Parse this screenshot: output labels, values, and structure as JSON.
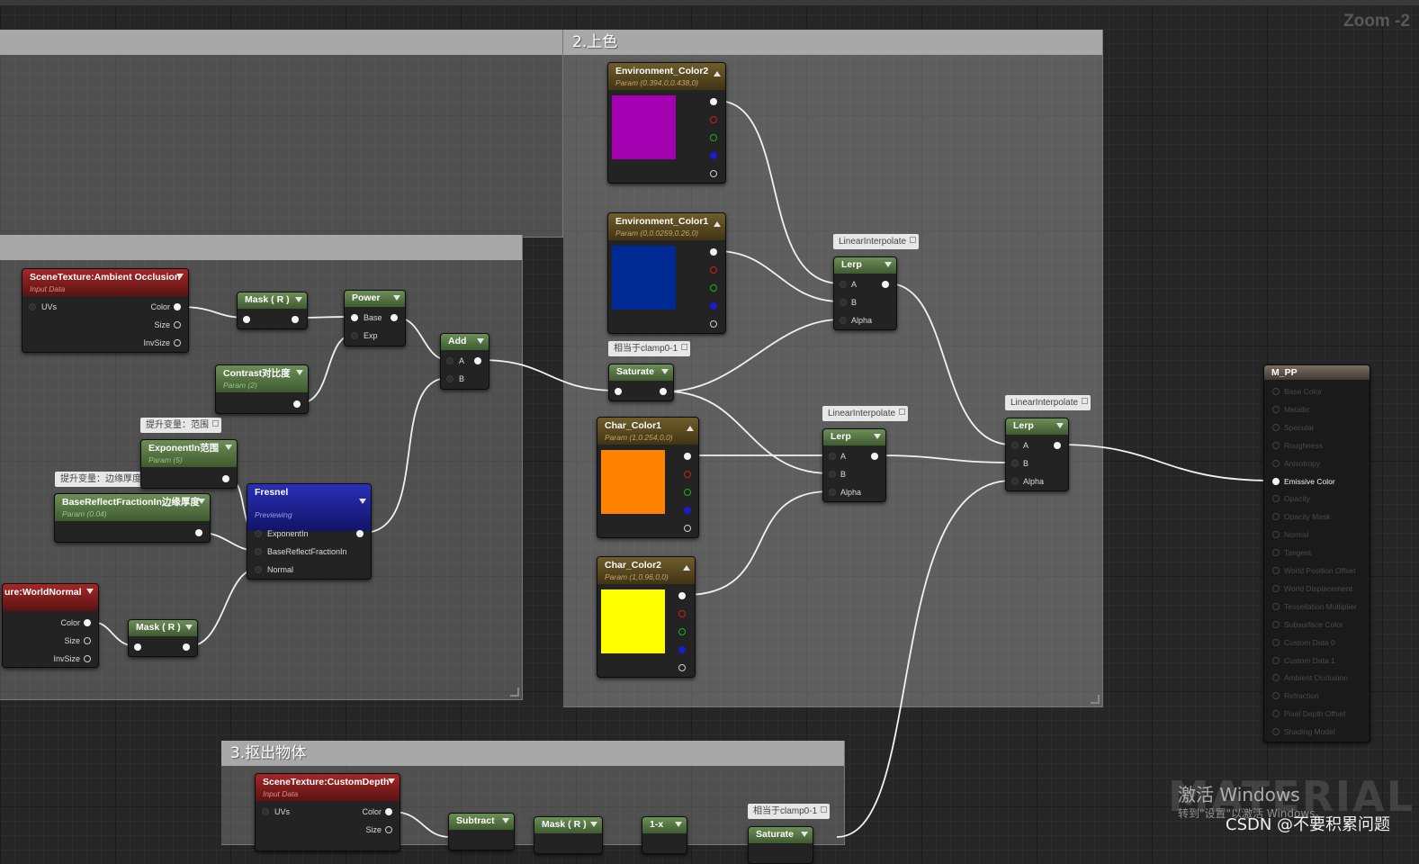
{
  "zoom_label": "Zoom -2",
  "comments": {
    "coloring": "2.上色",
    "extract": "3.抠出物体"
  },
  "annotations": {
    "lerp1": "LinearInterpolate",
    "lerp2": "LinearInterpolate",
    "lerp3": "LinearInterpolate",
    "clamp1": "相当于clamp0-1",
    "clamp2": "相当于clamp0-1",
    "promote_range": "提升变量：范围",
    "promote_edge": "提升变量：边缘厚度"
  },
  "nodes": {
    "env2": {
      "title": "Environment_Color2",
      "subtitle": "Param (0.394,0,0.438,0)",
      "color": "#a200b0"
    },
    "env1": {
      "title": "Environment_Color1",
      "subtitle": "Param (0,0.0259,0.26,0)",
      "color": "#002a93"
    },
    "char1": {
      "title": "Char_Color1",
      "subtitle": "Param (1,0.254,0,0)",
      "color": "#ff8200"
    },
    "char2": {
      "title": "Char_Color2",
      "subtitle": "Param (1,0.96,0,0)",
      "color": "#ffff00"
    },
    "ao": {
      "title": "SceneTexture:Ambient Occlusion",
      "subtitle": "Input Data",
      "pin_uvs": "UVs",
      "pin_color": "Color",
      "pin_size": "Size",
      "pin_invsize": "InvSize"
    },
    "mask1": {
      "title": "Mask ( R )"
    },
    "power": {
      "title": "Power",
      "pin_base": "Base",
      "pin_exp": "Exp"
    },
    "add": {
      "title": "Add",
      "pin_a": "A",
      "pin_b": "B"
    },
    "contrast": {
      "title": "Contrast对比度",
      "subtitle": "Param (2)"
    },
    "exponent": {
      "title": "ExponentIn范围",
      "subtitle": "Param (5)"
    },
    "basereflect": {
      "title": "BaseReflectFractionIn边缘厚度",
      "subtitle": "Param (0.04)"
    },
    "fresnel": {
      "title": "Fresnel",
      "subtitle": "Previewing",
      "pin_exponent": "ExponentIn",
      "pin_base": "BaseReflectFractionIn",
      "pin_normal": "Normal"
    },
    "worldnormal": {
      "title": "ure:WorldNormal",
      "pin_color": "Color",
      "pin_size": "Size",
      "pin_invsize": "InvSize"
    },
    "mask2": {
      "title": "Mask ( R )"
    },
    "saturate1": {
      "title": "Saturate"
    },
    "lerp1": {
      "title": "Lerp",
      "pin_a": "A",
      "pin_b": "B",
      "pin_alpha": "Alpha"
    },
    "lerp2": {
      "title": "Lerp",
      "pin_a": "A",
      "pin_b": "B",
      "pin_alpha": "Alpha"
    },
    "lerp3": {
      "title": "Lerp",
      "pin_a": "A",
      "pin_b": "B",
      "pin_alpha": "Alpha"
    },
    "customdepth": {
      "title": "SceneTexture:CustomDepth",
      "subtitle": "Input Data",
      "pin_uvs": "UVs",
      "pin_color": "Color",
      "pin_size": "Size"
    },
    "subtract": {
      "title": "Subtract"
    },
    "mask3": {
      "title": "Mask ( R )"
    },
    "oneminus": {
      "title": "1-x"
    },
    "saturate2": {
      "title": "Saturate"
    },
    "mpp": {
      "title": "M_PP",
      "pins": [
        "Base Color",
        "Metallic",
        "Specular",
        "Roughness",
        "Anisotropy",
        "Emissive Color",
        "Opacity",
        "Opacity Mask",
        "Normal",
        "Tangent",
        "World Position Offset",
        "World Displacement",
        "Tessellation Multiplier",
        "Subsurface Color",
        "Custom Data 0",
        "Custom Data 1",
        "Ambient Occlusion",
        "Refraction",
        "Pixel Depth Offset",
        "Shading Model"
      ],
      "active_pin": "Emissive Color"
    }
  },
  "watermark": "MATERIAL",
  "activation": {
    "line1": "激活 Windows",
    "line2": "转到\"设置\"以激活 Windows。"
  },
  "credit": "CSDN @不要积累问题"
}
